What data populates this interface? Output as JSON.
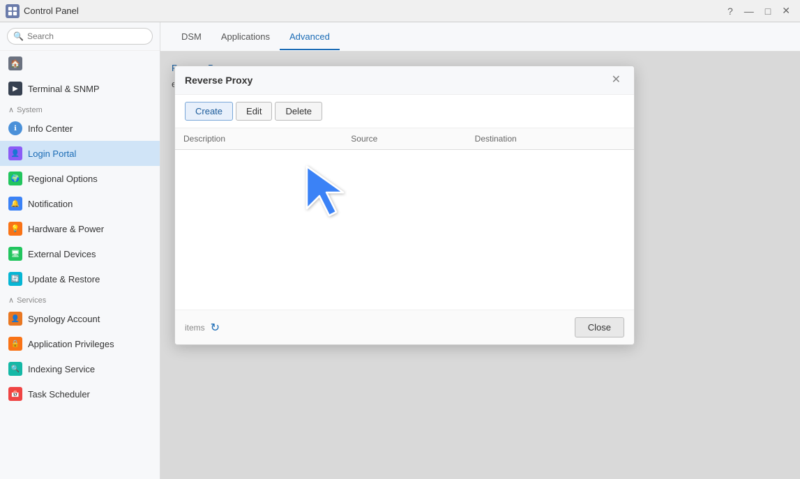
{
  "titlebar": {
    "title": "Control Panel",
    "controls": [
      "?",
      "—",
      "□",
      "✕"
    ]
  },
  "sidebar": {
    "search_placeholder": "Search",
    "nav_home_label": "",
    "terminal_label": "Terminal & SNMP",
    "system_section": "System",
    "items": [
      {
        "id": "info-center",
        "label": "Info Center",
        "icon": "ℹ",
        "color": "icon-blue"
      },
      {
        "id": "login-portal",
        "label": "Login Portal",
        "icon": "👤",
        "color": "icon-purple",
        "active": true
      },
      {
        "id": "regional-options",
        "label": "Regional Options",
        "icon": "🌍",
        "color": "icon-green"
      },
      {
        "id": "notification",
        "label": "Notification",
        "icon": "🔔",
        "color": "icon-blue"
      },
      {
        "id": "hardware-power",
        "label": "Hardware & Power",
        "icon": "💡",
        "color": "icon-orange"
      },
      {
        "id": "external-devices",
        "label": "External Devices",
        "icon": "🖥",
        "color": "icon-green"
      },
      {
        "id": "update-restore",
        "label": "Update & Restore",
        "icon": "🔄",
        "color": "icon-cyan"
      }
    ],
    "services_section": "Services",
    "service_items": [
      {
        "id": "synology-account",
        "label": "Synology Account",
        "icon": "👤",
        "color": "icon-synology"
      },
      {
        "id": "application-privileges",
        "label": "Application Privileges",
        "icon": "🔒",
        "color": "icon-orange"
      },
      {
        "id": "indexing-service",
        "label": "Indexing Service",
        "icon": "🔍",
        "color": "icon-teal"
      },
      {
        "id": "task-scheduler",
        "label": "Task Scheduler",
        "icon": "📅",
        "color": "icon-red"
      }
    ]
  },
  "tabs": [
    {
      "id": "dsm",
      "label": "DSM"
    },
    {
      "id": "applications",
      "label": "Applications"
    },
    {
      "id": "advanced",
      "label": "Advanced",
      "active": true
    }
  ],
  "content": {
    "link_label": "Reverse Proxy",
    "description": "evices in the local network."
  },
  "dialog": {
    "title": "Reverse Proxy",
    "toolbar": {
      "create_label": "Create",
      "edit_label": "Edit",
      "delete_label": "Delete"
    },
    "table": {
      "columns": [
        "Description",
        "Source",
        "Destination"
      ]
    },
    "footer": {
      "items_label": "items",
      "close_label": "Close"
    }
  }
}
